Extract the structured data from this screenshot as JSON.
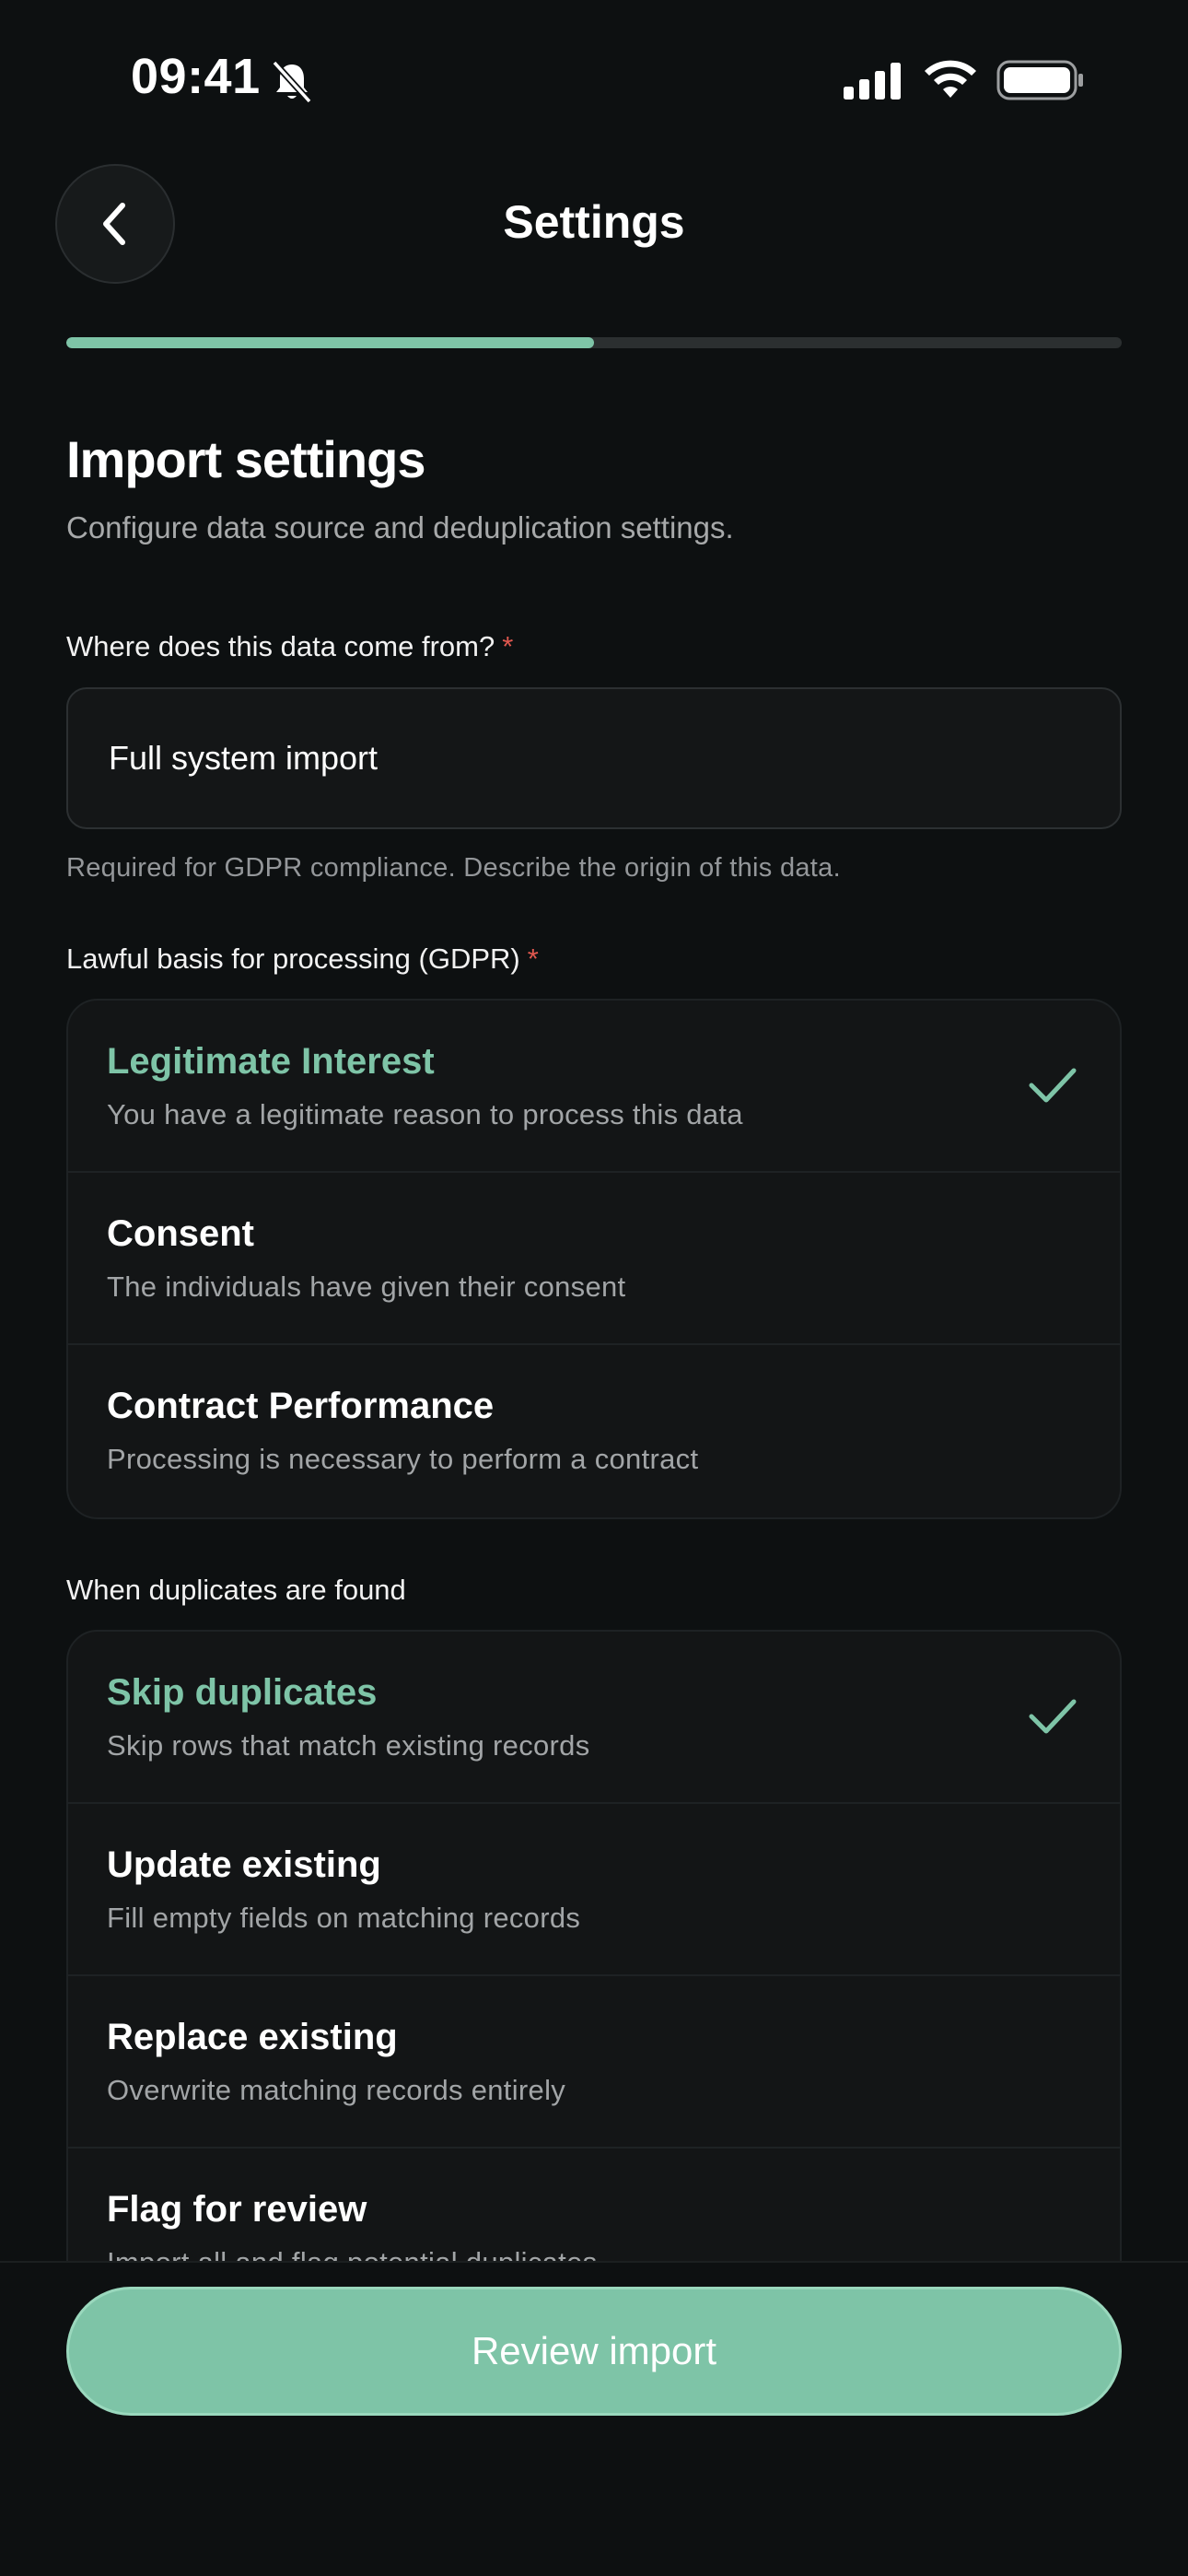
{
  "status_bar": {
    "time": "09:41",
    "icons": [
      "bell-slash-icon",
      "signal-icon",
      "wifi-icon",
      "battery-icon"
    ]
  },
  "header": {
    "title": "Settings",
    "back_icon": "chevron-left-icon"
  },
  "progress": {
    "fraction": 0.5
  },
  "section": {
    "title": "Import settings",
    "subtitle": "Configure data source and deduplication settings."
  },
  "source_field": {
    "label": "Where does this data come from?",
    "required_mark": "*",
    "value": "Full system import",
    "helper": "Required for GDPR compliance. Describe the origin of this data."
  },
  "lawful_basis": {
    "label": "Lawful basis for processing (GDPR)",
    "required_mark": "*",
    "options": [
      {
        "title": "Legitimate Interest",
        "description": "You have a legitimate reason to process this data",
        "selected": true
      },
      {
        "title": "Consent",
        "description": "The individuals have given their consent",
        "selected": false
      },
      {
        "title": "Contract Performance",
        "description": "Processing is necessary to perform a contract",
        "selected": false
      }
    ]
  },
  "duplicates": {
    "label": "When duplicates are found",
    "options": [
      {
        "title": "Skip duplicates",
        "description": "Skip rows that match existing records",
        "selected": true
      },
      {
        "title": "Update existing",
        "description": "Fill empty fields on matching records",
        "selected": false
      },
      {
        "title": "Replace existing",
        "description": "Overwrite matching records entirely",
        "selected": false
      },
      {
        "title": "Flag for review",
        "description": "Import all and flag potential duplicates",
        "selected": false
      }
    ]
  },
  "footer": {
    "review_label": "Review import"
  },
  "colors": {
    "accent": "#7ec4a7",
    "background": "#0d1011",
    "required": "#e0584f"
  }
}
